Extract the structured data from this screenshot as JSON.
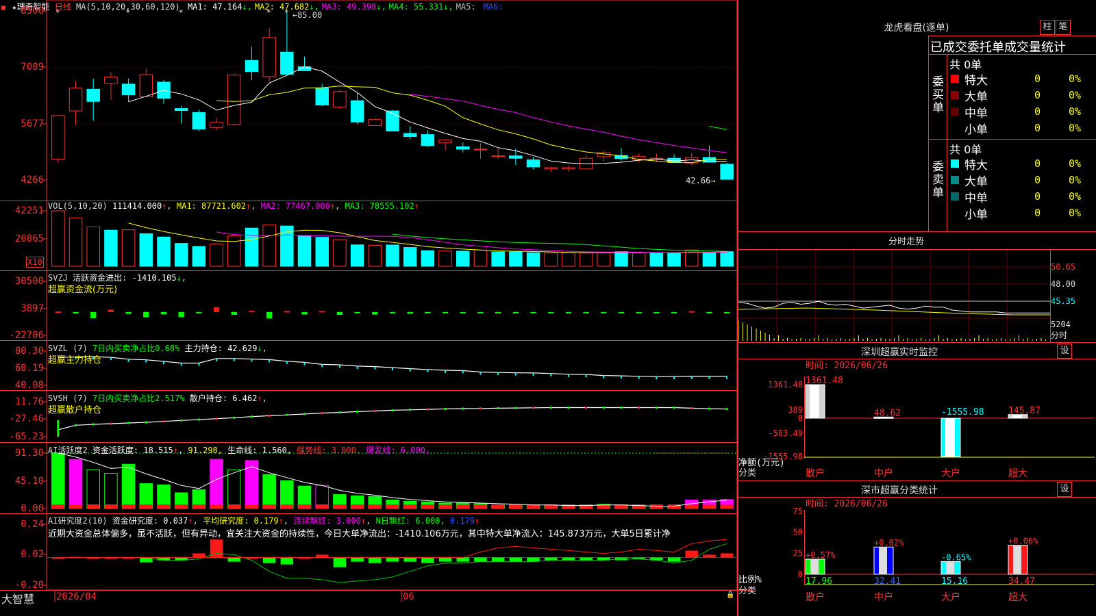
{
  "app": {
    "brand": "大智慧"
  },
  "header": {
    "stock_name": "理奇智能",
    "period": "日线",
    "ma_params": "MA(5,10,20,30,60,120)",
    "ma_values": [
      {
        "label": "MA1:",
        "value": "47.164",
        "arrow": "↓",
        "color": "#ffffff"
      },
      {
        "label": "MA2:",
        "value": "47.682",
        "arrow": "↓",
        "color": "#ffff00"
      },
      {
        "label": "MA3:",
        "value": "49.398",
        "arrow": "↓",
        "color": "#ff00ff"
      },
      {
        "label": "MA4:",
        "value": "55.331",
        "arrow": "↓",
        "color": "#00ff00"
      },
      {
        "label": "MA5:",
        "value": "",
        "arrow": "",
        "color": "#c0c0c0"
      },
      {
        "label": "MA6:",
        "value": "",
        "arrow": "",
        "color": "#3050ff"
      }
    ],
    "high_label": "85.00",
    "low_label": "42.66"
  },
  "axes": {
    "price_ticks": [
      "8500",
      "7089",
      "5677",
      "4266"
    ],
    "vol_ticks": [
      "42251",
      "20865"
    ],
    "vol_unit": "X10",
    "svzj_ticks": [
      "30500",
      "3897",
      "-22706"
    ],
    "svzl_ticks": [
      "80.30",
      "60.19",
      "40.08"
    ],
    "svsh_ticks": [
      "11.76",
      "-27.46",
      "-65.23"
    ],
    "ai1_ticks": [
      "91.30",
      "45.10",
      "0.00"
    ],
    "ai2_ticks": [
      "0.24",
      "0.02",
      "-0.20"
    ]
  },
  "indicators": {
    "vol": {
      "name": "VOL(5,10,20)",
      "value": "111414.000",
      "ma1": "MA1: 87721.602",
      "ma2": "MA2: 77467.000",
      "ma3": "MA3: 78555.102"
    },
    "svzj": {
      "name": "SVZJ",
      "label": "活跃资金进出: -1410.105",
      "sub": "超赢资金流(万元)"
    },
    "svzl": {
      "name": "SVZL (7)",
      "label1": "7日内买卖净占比0.68%",
      "label2": "主力持仓: 42.629",
      "sub": "超赢主力持仓"
    },
    "svsh": {
      "name": "SVSH (7)",
      "label1": "7日内买卖净占比2.517%",
      "label2": "散户持仓: 6.462",
      "sub": "超赢散户持仓"
    },
    "ai1": {
      "name": "AI活跃度2",
      "label1": "资金活跃度: 18.515",
      "label2": "91.298,",
      "label3": "生命线: 1.560,",
      "label4": "强势线: 3.000,",
      "label5": "爆发线: 6.000,"
    },
    "ai2": {
      "name": "AI研究度2(10)",
      "label1": "资金研究度: 0.037",
      "label2": "平均研究度: 0.179",
      "label3": "连续飘红: 3.000",
      "label4": "N日飘红: 6.000,",
      "label5": "0.179",
      "comment": "近期大资金总体偏多，虽不活跃，但有异动，宜关注大资金的持续性，今日大单净流出：-1410.106万元，其中特大单净流入：145.873万元，大单5日累计净"
    }
  },
  "date_axis": {
    "left": "2026/04",
    "mid": "06"
  },
  "right": {
    "dragon": {
      "title": "龙虎看盘(逐单)",
      "btn_bar": "柱",
      "btn_pen": "笔",
      "stat_title": "已成交委托单成交量统计",
      "buy_label": "委买单",
      "sell_label": "委卖单",
      "buy_total": "共 0单",
      "sell_total": "共 0单",
      "buy_rows": [
        {
          "name": "特大",
          "count": "0",
          "pct": "0%"
        },
        {
          "name": "大单",
          "count": "0",
          "pct": "0%"
        },
        {
          "name": "中单",
          "count": "0",
          "pct": "0%"
        },
        {
          "name": "小单",
          "count": "0",
          "pct": "0%"
        }
      ],
      "sell_rows": [
        {
          "name": "特大",
          "count": "0",
          "pct": "0%"
        },
        {
          "name": "大单",
          "count": "0",
          "pct": "0%"
        },
        {
          "name": "中单",
          "count": "0",
          "pct": "0%"
        },
        {
          "name": "小单",
          "count": "0",
          "pct": "0%"
        }
      ]
    },
    "fenshi": {
      "title": "分时走势",
      "ticks": [
        "50.65",
        "48.00",
        "45.35"
      ],
      "vol_tick": "5204",
      "vol_label": "分时"
    },
    "monitor": {
      "title": "深圳超赢实时监控",
      "set": "设",
      "time": "时间: 2026/06/26",
      "ticks": [
        "1361.48",
        "389",
        "0",
        "-583.49",
        "-1555.98"
      ],
      "ylabel": "净额(万元)",
      "xlabel": "分类",
      "categories": [
        "散户",
        "中户",
        "大户",
        "超大"
      ],
      "values": [
        1361.48,
        48.62,
        -1555.98,
        145.87
      ],
      "value_labels": [
        "1361.48",
        "48.62",
        "-1555.98",
        "145.87"
      ]
    },
    "classify": {
      "title": "深市超赢分类统计",
      "set": "设",
      "time": "时间: 2026/06/26",
      "ticks": [
        "75",
        "50",
        "25",
        "0"
      ],
      "ylabel": "比例%",
      "xlabel": "分类",
      "categories": [
        "散户",
        "中户",
        "大户",
        "超大"
      ],
      "values": [
        17.96,
        32.41,
        15.16,
        34.47
      ],
      "change_labels": [
        "+0.57%",
        "+0.02%",
        "-0.65%",
        "+0.06%"
      ]
    }
  },
  "chart_data": [
    {
      "type": "candlestick",
      "title": "理奇智能 日线",
      "ylim": [
        42.66,
        85.0
      ],
      "candles": [
        {
          "o": 47.8,
          "h": 58.8,
          "l": 46.9,
          "c": 58.8
        },
        {
          "o": 60.0,
          "h": 67.5,
          "l": 56.5,
          "c": 65.8
        },
        {
          "o": 65.5,
          "h": 68.2,
          "l": 57.5,
          "c": 62.4
        },
        {
          "o": 67.0,
          "h": 69.8,
          "l": 62.8,
          "c": 68.6
        },
        {
          "o": 66.8,
          "h": 68.2,
          "l": 62.3,
          "c": 64.1
        },
        {
          "o": 63.6,
          "h": 70.8,
          "l": 63.6,
          "c": 69.2
        },
        {
          "o": 67.3,
          "h": 67.8,
          "l": 61.8,
          "c": 63.2
        },
        {
          "o": 60.6,
          "h": 61.2,
          "l": 56.8,
          "c": 60.1
        },
        {
          "o": 59.6,
          "h": 60.3,
          "l": 54.9,
          "c": 55.4
        },
        {
          "o": 55.8,
          "h": 58.2,
          "l": 55.2,
          "c": 57.1
        },
        {
          "o": 56.6,
          "h": 69.5,
          "l": 56.3,
          "c": 69.1
        },
        {
          "o": 72.8,
          "h": 76.3,
          "l": 67.8,
          "c": 70.0
        },
        {
          "o": 68.7,
          "h": 81.0,
          "l": 67.5,
          "c": 78.6
        },
        {
          "o": 74.9,
          "h": 85.0,
          "l": 69.3,
          "c": 69.3
        },
        {
          "o": 71.2,
          "h": 73.8,
          "l": 70.2,
          "c": 70.2
        },
        {
          "o": 65.8,
          "h": 66.8,
          "l": 61.2,
          "c": 61.5
        },
        {
          "o": 61.0,
          "h": 65.4,
          "l": 60.5,
          "c": 64.9
        },
        {
          "o": 62.6,
          "h": 64.5,
          "l": 56.6,
          "c": 57.2
        },
        {
          "o": 56.3,
          "h": 58.2,
          "l": 56.3,
          "c": 57.8
        },
        {
          "o": 60.0,
          "h": 60.3,
          "l": 54.9,
          "c": 54.9
        },
        {
          "o": 54.3,
          "h": 56.2,
          "l": 52.9,
          "c": 53.5
        },
        {
          "o": 54.0,
          "h": 55.0,
          "l": 50.9,
          "c": 51.2
        },
        {
          "o": 51.9,
          "h": 52.9,
          "l": 49.9,
          "c": 52.6
        },
        {
          "o": 50.9,
          "h": 52.0,
          "l": 49.5,
          "c": 50.3
        },
        {
          "o": 50.3,
          "h": 51.8,
          "l": 47.9,
          "c": 50.3
        },
        {
          "o": 48.4,
          "h": 50.5,
          "l": 47.8,
          "c": 48.6
        },
        {
          "o": 48.6,
          "h": 50.5,
          "l": 46.3,
          "c": 48.0
        },
        {
          "o": 47.6,
          "h": 48.3,
          "l": 45.2,
          "c": 45.8
        },
        {
          "o": 45.3,
          "h": 45.8,
          "l": 44.5,
          "c": 45.6
        },
        {
          "o": 45.3,
          "h": 46.1,
          "l": 44.6,
          "c": 45.6
        },
        {
          "o": 45.3,
          "h": 48.8,
          "l": 45.3,
          "c": 48.0
        },
        {
          "o": 48.4,
          "h": 49.8,
          "l": 47.2,
          "c": 49.4
        },
        {
          "o": 48.7,
          "h": 50.6,
          "l": 47.4,
          "c": 47.9
        },
        {
          "o": 47.8,
          "h": 49.2,
          "l": 47.0,
          "c": 48.5
        },
        {
          "o": 48.0,
          "h": 49.2,
          "l": 47.1,
          "c": 48.0
        },
        {
          "o": 48.0,
          "h": 49.0,
          "l": 46.9,
          "c": 46.9
        },
        {
          "o": 46.8,
          "h": 49.4,
          "l": 46.2,
          "c": 48.2
        },
        {
          "o": 48.2,
          "h": 51.2,
          "l": 48.2,
          "c": 47.0
        },
        {
          "o": 46.5,
          "h": 46.8,
          "l": 42.66,
          "c": 42.66
        }
      ],
      "ma": {
        "MA1": [
          null,
          null,
          null,
          null,
          62.3,
          63.7,
          65.2,
          64.3,
          62.8,
          60.2,
          61.4,
          62.2,
          67.1,
          69.0,
          71.2,
          70.1,
          67.3,
          64.7,
          61.1,
          59.4,
          57.2,
          55.7,
          54.3,
          53.0,
          52.3,
          50.7,
          49.9,
          48.7,
          47.3,
          46.8,
          46.6,
          46.7,
          47.0,
          47.5,
          47.8,
          47.3,
          47.6,
          47.2,
          47.2
        ],
        "MA2": [
          null,
          null,
          null,
          null,
          null,
          null,
          null,
          null,
          null,
          62.6,
          62.4,
          62.6,
          64.1,
          64.7,
          65.8,
          65.9,
          66.3,
          66.1,
          66.0,
          64.6,
          64.0,
          62.7,
          61.2,
          58.3,
          56.7,
          55.2,
          54.2,
          52.9,
          51.4,
          50.4,
          49.6,
          49.1,
          48.6,
          47.7,
          47.3,
          47.0,
          46.9,
          47.7,
          47.7
        ],
        "MA3": [
          null,
          null,
          null,
          null,
          null,
          null,
          null,
          null,
          null,
          null,
          null,
          null,
          null,
          null,
          null,
          null,
          null,
          null,
          null,
          null,
          64.2,
          63.7,
          63.1,
          62.5,
          61.4,
          60.4,
          59.6,
          58.3,
          57.2,
          56.2,
          55.4,
          54.6,
          53.6,
          52.7,
          52.0,
          51.2,
          50.6,
          50.0,
          49.4
        ],
        "MA4": [
          null,
          null,
          null,
          null,
          null,
          null,
          null,
          null,
          null,
          null,
          null,
          null,
          null,
          null,
          null,
          null,
          null,
          null,
          null,
          null,
          null,
          null,
          null,
          null,
          null,
          null,
          null,
          null,
          null,
          null,
          null,
          null,
          null,
          null,
          null,
          null,
          null,
          56.1,
          55.3
        ]
      }
    },
    {
      "type": "bar",
      "title": "VOL(5,10,20)",
      "unit": "X10",
      "values": [
        42251,
        36900,
        30000,
        27500,
        27800,
        24800,
        22300,
        17400,
        15100,
        16900,
        23100,
        29100,
        31400,
        30700,
        23400,
        22100,
        20300,
        16300,
        16000,
        16200,
        14300,
        11900,
        11600,
        11500,
        12400,
        11000,
        10900,
        10300,
        10100,
        10200,
        10100,
        10400,
        11100,
        10100,
        10200,
        10100,
        12400,
        10600,
        11100
      ],
      "up": [
        true,
        true,
        true,
        false,
        true,
        false,
        false,
        false,
        false,
        true,
        true,
        false,
        true,
        false,
        false,
        false,
        true,
        false,
        true,
        false,
        false,
        false,
        true,
        false,
        true,
        false,
        false,
        false,
        true,
        true,
        true,
        true,
        false,
        true,
        false,
        false,
        true,
        false,
        false
      ]
    },
    {
      "type": "bar",
      "title": "SVZJ 活跃资金进出",
      "ylim": [
        -22706,
        30500
      ],
      "values": [
        500,
        -1500,
        -6000,
        2200,
        -1800,
        -5100,
        -2300,
        -5000,
        -200,
        4700,
        -2700,
        1100,
        -6300,
        900,
        -2400,
        900,
        -2800,
        -1300,
        -2500,
        -1200,
        -1700,
        -1100,
        -1100,
        -600,
        -300,
        -300,
        -400,
        -400,
        -400,
        -400,
        -600,
        -400,
        -300,
        -600,
        -600,
        -600,
        800,
        -400,
        -300
      ]
    },
    {
      "type": "line",
      "title": "SVZL 主力持仓",
      "ylim": [
        40.08,
        80.3
      ],
      "values": [
        72.8,
        73.6,
        73.9,
        73.0,
        70.8,
        70.1,
        68.2,
        66.2,
        66.2,
        71.6,
        71.6,
        71.0,
        70.3,
        68.4,
        67.1,
        64.7,
        64.2,
        62.7,
        62.1,
        60.9,
        59.7,
        58.6,
        57.8,
        57.4,
        55.8,
        55.2,
        54.9,
        54.6,
        54.0,
        53.1,
        52.8,
        51.7,
        51.3,
        50.7,
        50.3,
        50.4,
        50.6,
        50.6,
        50.7
      ]
    },
    {
      "type": "line",
      "title": "SVSH 散户持仓",
      "ylim": [
        -65.23,
        11.76
      ],
      "values": [
        -50.0,
        -40.0,
        -38.0,
        -36.5,
        -35.0,
        -33.5,
        -31.5,
        -29.5,
        -27.5,
        -25.5,
        -23.5,
        -21.0,
        -19.0,
        -17.2,
        -15.2,
        -13.2,
        -11.8,
        -10.0,
        -8.5,
        -7.0,
        -6.0,
        -5.0,
        -4.0,
        -3.4,
        -3.0,
        -2.5,
        -2.0,
        -1.5,
        -1.0,
        -1.0,
        -1.0,
        -1.0,
        -1.0,
        -1.0,
        -1.0,
        -1.0,
        -2.5,
        -3.5,
        -4.2
      ]
    },
    {
      "type": "bar",
      "title": "AI活跃度2",
      "ylim": [
        0,
        91.3
      ],
      "values": [
        91.3,
        81.0,
        64.0,
        58.0,
        73.0,
        41.0,
        39.0,
        26.0,
        31.0,
        81.0,
        64.0,
        79.0,
        56.0,
        46.0,
        37.0,
        38.0,
        23.0,
        21.0,
        20.0,
        14.0,
        12.0,
        11.0,
        9.0,
        9.0,
        8.0,
        6.0,
        6.0,
        5.0,
        5.0,
        4.0,
        5.0,
        7.0,
        6.0,
        5.0,
        4.0,
        3.0,
        14.0,
        14.0,
        15.0
      ],
      "line": [
        91.3,
        85.0,
        76.0,
        66.0,
        68.0,
        57.0,
        48.0,
        38.0,
        33.0,
        48.0,
        59.0,
        69.0,
        59.0,
        51.0,
        43.0,
        38.0,
        30.0,
        25.0,
        22.0,
        18.0,
        15.0,
        13.0,
        11.0,
        10.0,
        9.0,
        8.0,
        7.0,
        6.0,
        6.0,
        5.0,
        5.0,
        6.0,
        6.0,
        5.0,
        4.0,
        4.0,
        8.0,
        11.0,
        14.0
      ]
    },
    {
      "type": "bar",
      "title": "AI研究度2(10)",
      "ylim": [
        -0.2,
        0.24
      ],
      "values": [
        0.0,
        0.005,
        0.0,
        0.0,
        0.0,
        -0.035,
        -0.02,
        -0.02,
        0.03,
        0.13,
        -0.03,
        0.0,
        -0.04,
        -0.05,
        0.0,
        0.02,
        -0.07,
        -0.03,
        -0.04,
        -0.03,
        -0.03,
        -0.04,
        -0.03,
        -0.03,
        -0.03,
        -0.03,
        -0.03,
        -0.03,
        -0.02,
        -0.02,
        -0.02,
        -0.02,
        -0.02,
        -0.01,
        -0.02,
        -0.03,
        0.05,
        0.02,
        0.03
      ],
      "line_green": [
        0.0,
        0.0,
        0.0,
        0.0,
        0.0,
        0.0,
        -0.02,
        -0.02,
        -0.01,
        0.03,
        0.02,
        -0.02,
        -0.1,
        -0.15,
        -0.15,
        -0.16,
        -0.18,
        -0.17,
        -0.16,
        -0.14,
        -0.1,
        -0.06,
        -0.04,
        -0.04,
        -0.03,
        -0.03,
        -0.03,
        -0.03,
        -0.02,
        -0.02,
        -0.02,
        -0.02,
        -0.01,
        -0.01,
        -0.02,
        -0.04,
        -0.02,
        0.06,
        0.1
      ],
      "line_red": [
        0.0,
        0.0,
        0.0,
        0.0,
        0.0,
        0.0,
        0.0,
        0.0,
        0.0,
        0.0,
        0.0,
        0.0,
        0.0,
        0.0,
        0.0,
        0.0,
        0.0,
        0.0,
        0.0,
        0.0,
        0.0,
        0.0,
        0.0,
        0.0,
        0.04,
        0.07,
        0.08,
        0.07,
        0.06,
        0.05,
        0.04,
        0.03,
        0.04,
        0.06,
        0.05,
        0.04,
        0.1,
        0.12,
        0.13
      ]
    },
    {
      "type": "line",
      "title": "分时走势",
      "ylim": [
        45.35,
        50.65
      ],
      "values": [
        47.0,
        46.9,
        46.6,
        46.4,
        46.5,
        46.9,
        47.0,
        46.8,
        46.9,
        47.1,
        46.8,
        46.7,
        46.8,
        46.6,
        46.4,
        46.5,
        46.6,
        46.7,
        46.4,
        46.3,
        46.4,
        46.6,
        46.5,
        46.5,
        46.2,
        46.1,
        46.0,
        46.0,
        46.0,
        46.0,
        45.9,
        45.9,
        45.9,
        45.9,
        45.9,
        45.9
      ]
    }
  ]
}
